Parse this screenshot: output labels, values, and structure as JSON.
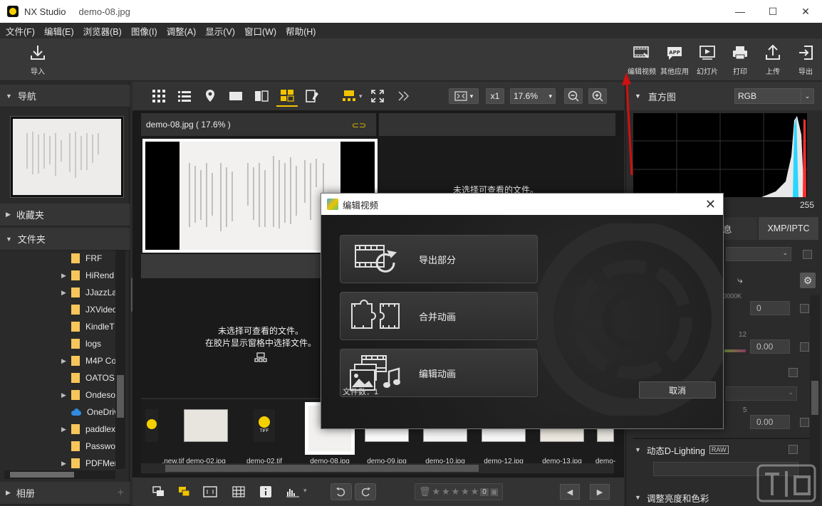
{
  "window": {
    "app_name": "NX Studio",
    "file_name": "demo-08.jpg",
    "minimize": "—",
    "maximize": "☐",
    "close": "✕"
  },
  "menu": [
    "文件(F)",
    "编辑(E)",
    "浏览器(B)",
    "图像(I)",
    "调整(A)",
    "显示(V)",
    "窗口(W)",
    "帮助(H)"
  ],
  "toolbar": {
    "import_label": "导入",
    "right_items": [
      {
        "label": "编辑视频",
        "icon": "edit-video-icon"
      },
      {
        "label": "其他应用",
        "icon": "app-icon"
      },
      {
        "label": "幻灯片",
        "icon": "slideshow-icon"
      },
      {
        "label": "打印",
        "icon": "print-icon"
      },
      {
        "label": "上传",
        "icon": "upload-icon"
      },
      {
        "label": "导出",
        "icon": "export-icon"
      }
    ],
    "app_badge": "APP"
  },
  "left_panel": {
    "navigation": "导航",
    "favorites": "收藏夹",
    "folders": "文件夹",
    "albums": "相册",
    "folder_items": [
      {
        "name": "FRF",
        "expandable": false,
        "type": "folder"
      },
      {
        "name": "HiRend",
        "expandable": true,
        "type": "folder"
      },
      {
        "name": "JJazzLab",
        "expandable": true,
        "type": "folder"
      },
      {
        "name": "JXVideo",
        "expandable": false,
        "type": "folder"
      },
      {
        "name": "KindleT",
        "expandable": false,
        "type": "folder"
      },
      {
        "name": "logs",
        "expandable": false,
        "type": "folder"
      },
      {
        "name": "M4P Co",
        "expandable": true,
        "type": "folder"
      },
      {
        "name": "OATOS",
        "expandable": false,
        "type": "folder"
      },
      {
        "name": "Ondeso",
        "expandable": true,
        "type": "folder"
      },
      {
        "name": "OneDriv",
        "expandable": false,
        "type": "cloud"
      },
      {
        "name": "paddlex",
        "expandable": true,
        "type": "folder"
      },
      {
        "name": "Passwo",
        "expandable": false,
        "type": "folder"
      },
      {
        "name": "PDFMer",
        "expandable": true,
        "type": "folder"
      }
    ]
  },
  "center": {
    "zoom_multiplier": "x1",
    "zoom_percent": "17.6%",
    "pane_title": "demo-08.jpg ( 17.6% )",
    "empty_right": "未选择可查看的文件。",
    "empty_bottom_line1": "未选择可查看的文件。",
    "empty_bottom_line2": "在胶片显示窗格中选择文件。",
    "filmstrip": [
      {
        "label": ".new.tif",
        "kind": "tif"
      },
      {
        "label": "demo-02.jpg",
        "kind": "jpg"
      },
      {
        "label": "demo-02.tif",
        "kind": "tif"
      },
      {
        "label": "demo-08.jpg",
        "kind": "jpg",
        "selected": true
      },
      {
        "label": "demo-09.jpg",
        "kind": "jpg"
      },
      {
        "label": "demo-10.jpg",
        "kind": "jpg"
      },
      {
        "label": "demo-12.jpg",
        "kind": "jpg"
      },
      {
        "label": "demo-13.jpg",
        "kind": "jpg"
      },
      {
        "label": "demo-",
        "kind": "jpg"
      }
    ],
    "tiff_badge": "TIFF",
    "rating_zero": "0"
  },
  "right_panel": {
    "histogram_title": "直方图",
    "channel": "RGB",
    "hist_max": "255",
    "tab_info": "息",
    "tab_xmp": "XMP/IPTC",
    "kelvin_label": "0000K",
    "val_0": "0",
    "val_12": "12",
    "val_000a": "0.00",
    "val_5": "5",
    "val_000b": "0.00",
    "dlighting": "动态D-Lighting",
    "raw_badge": "RAW",
    "next_section": "调整亮度和色彩"
  },
  "dialog": {
    "title": "编辑视频",
    "buttons": [
      {
        "label": "导出部分",
        "icon": "export-part-icon"
      },
      {
        "label": "合并动画",
        "icon": "merge-movie-icon"
      },
      {
        "label": "编辑动画",
        "icon": "edit-movie-icon"
      }
    ],
    "file_count": "文件数：1",
    "cancel": "取消"
  },
  "colors": {
    "accent_yellow": "#f0c400",
    "annotation_red": "#d01010",
    "folder_yellow": "#f6c65b",
    "onedrive_blue": "#2f8ae0"
  }
}
